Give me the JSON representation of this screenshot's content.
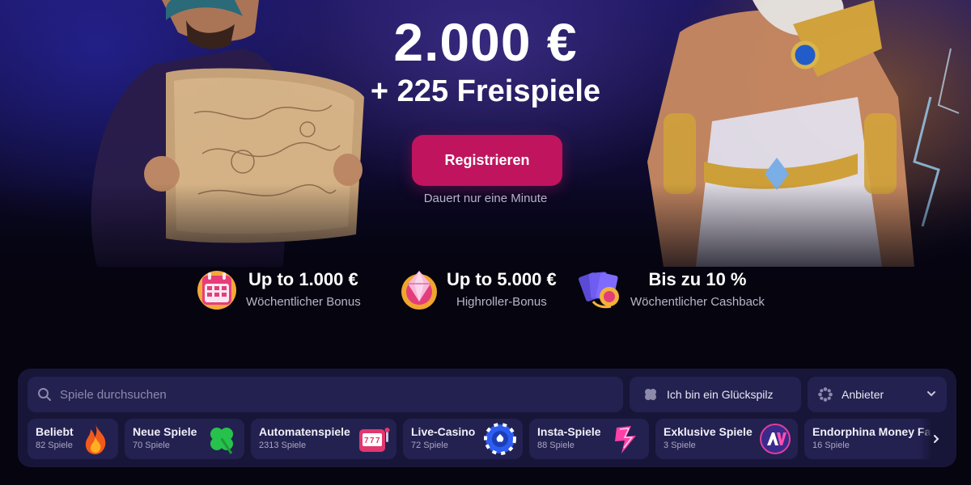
{
  "hero": {
    "amount": "2.000 €",
    "free_spins": "+ 225 Freispiele",
    "register_label": "Registrieren",
    "register_hint": "Dauert nur eine Minute"
  },
  "promos": [
    {
      "title": "Up to 1.000 €",
      "subtitle": "Wöchentlicher Bonus",
      "icon": "calendar-icon"
    },
    {
      "title": "Up to 5.000 €",
      "subtitle": "Highroller-Bonus",
      "icon": "gem-icon"
    },
    {
      "title": "Bis zu 10 %",
      "subtitle": "Wöchentlicher Cashback",
      "icon": "cards-icon"
    }
  ],
  "search": {
    "placeholder": "Spiele durchsuchen"
  },
  "lucky": {
    "label": "Ich bin ein Glückspilz"
  },
  "provider": {
    "label": "Anbieter"
  },
  "categories": [
    {
      "name": "Beliebt",
      "count": "82 Spiele",
      "icon": "flame-icon"
    },
    {
      "name": "Neue Spiele",
      "count": "70 Spiele",
      "icon": "clover-icon"
    },
    {
      "name": "Automatenspiele",
      "count": "2313 Spiele",
      "icon": "slot-machine-icon"
    },
    {
      "name": "Live-Casino",
      "count": "72 Spiele",
      "icon": "poker-chip-icon"
    },
    {
      "name": "Insta-Spiele",
      "count": "88 Spiele",
      "icon": "lightning-icon"
    },
    {
      "name": "Exklusive Spiele",
      "count": "3 Spiele",
      "icon": "exclusive-logo-icon"
    },
    {
      "name": "Endorphina Money Fa",
      "count": "16 Spiele",
      "icon": ""
    }
  ],
  "colors": {
    "accent": "#c0145e",
    "panel": "#181638",
    "field": "#232150"
  }
}
